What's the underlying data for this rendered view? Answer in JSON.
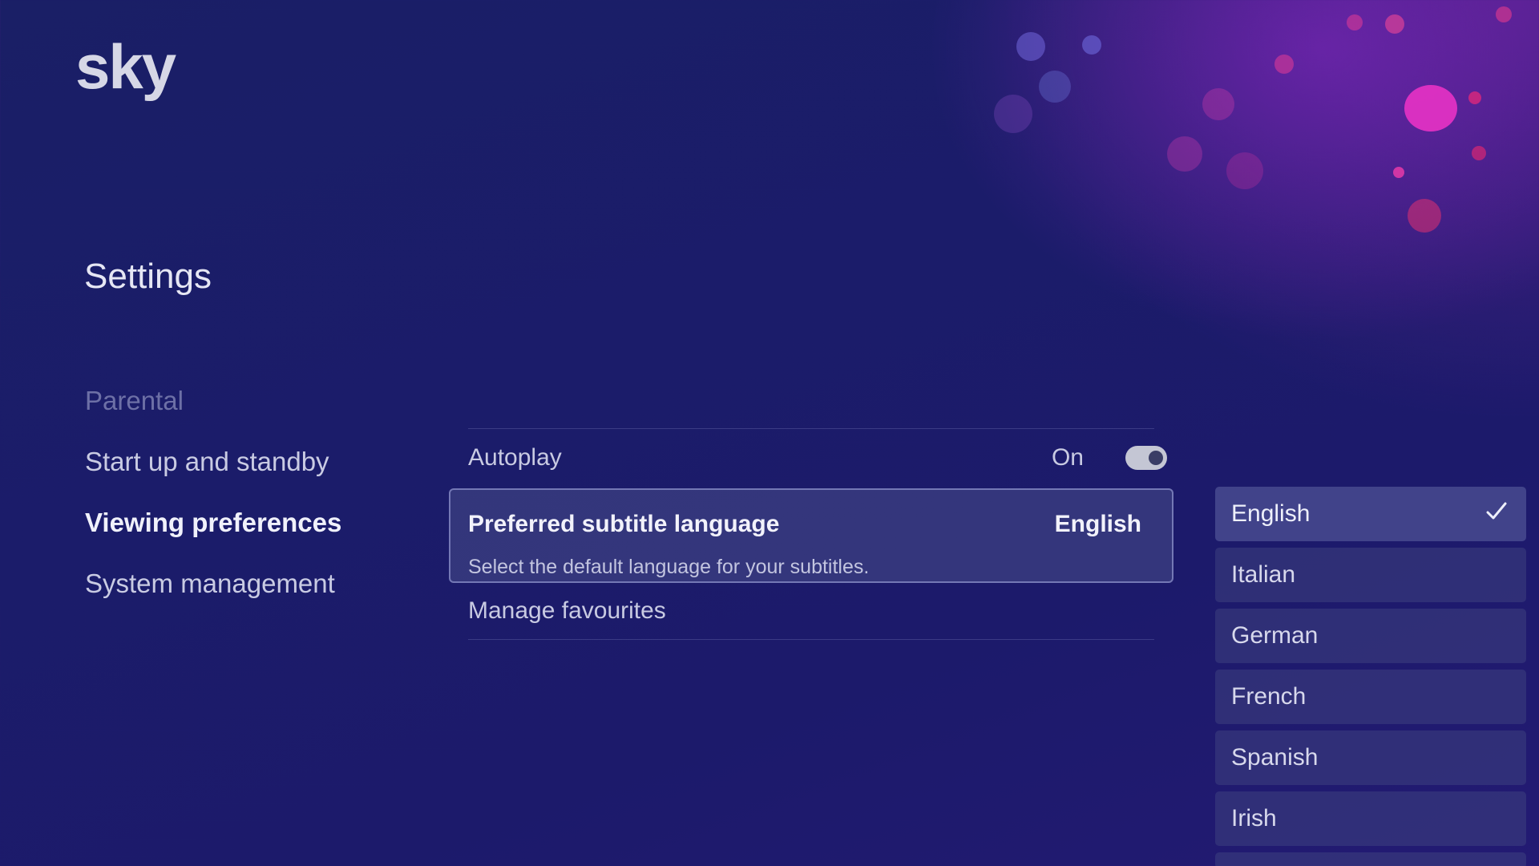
{
  "brand": {
    "logo_text": "sky"
  },
  "page": {
    "title": "Settings"
  },
  "nav": {
    "items": [
      {
        "label": "Parental"
      },
      {
        "label": "Start up and standby"
      },
      {
        "label": "Viewing preferences"
      },
      {
        "label": "System management"
      }
    ],
    "active_index": 2
  },
  "menu": {
    "autoplay": {
      "label": "Autoplay",
      "state": "On",
      "enabled": true
    },
    "subtitle": {
      "label": "Preferred subtitle language",
      "value": "English",
      "description": "Select the default language for your subtitles."
    },
    "favourites": {
      "label": "Manage favourites"
    }
  },
  "languages": {
    "options": [
      {
        "label": "English"
      },
      {
        "label": "Italian"
      },
      {
        "label": "German"
      },
      {
        "label": "French"
      },
      {
        "label": "Spanish"
      },
      {
        "label": "Irish"
      }
    ],
    "selected": "English",
    "check_icon": "checkmark-icon"
  },
  "colors": {
    "accent": "#f2f2fb",
    "background": "#1b1c6a",
    "toggle_on": "#c4c6d4"
  }
}
